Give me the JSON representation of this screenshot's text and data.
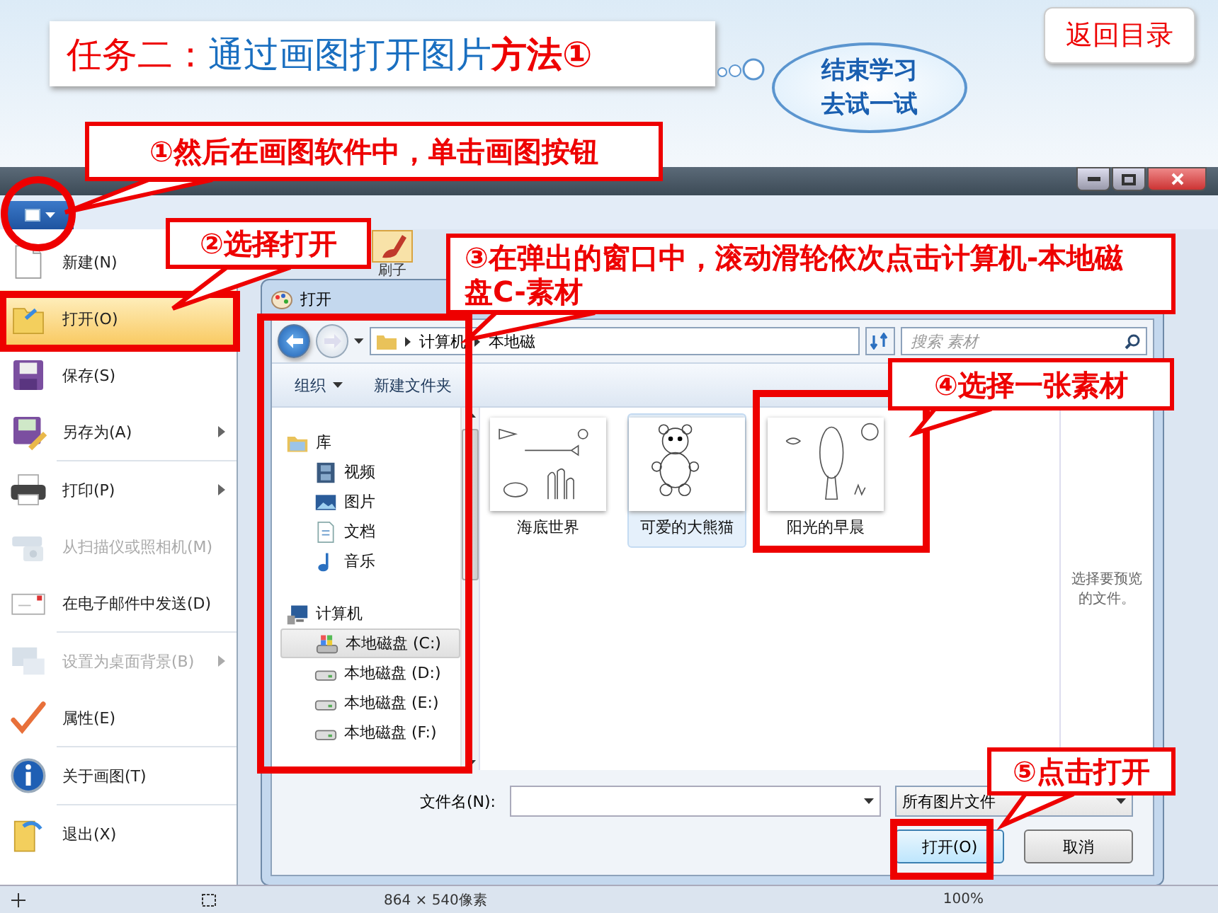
{
  "slide": {
    "title_label": "任务二：",
    "title_text": "通过画图打开图片",
    "title_emphasis": "方法①",
    "bubble_lines": [
      "结束学习",
      "去试一试"
    ],
    "back_button": "返回目录"
  },
  "callouts": [
    {
      "text": "①然后在画图软件中，单击画图按钮"
    },
    {
      "text": "②选择打开"
    },
    {
      "text": "③在弹出的窗口中，滚动滑轮依次点击计算机-本地磁盘C-素材"
    },
    {
      "text": "④选择一张素材"
    },
    {
      "text": "⑤点击打开"
    }
  ],
  "paint": {
    "ribbon_label": "刷子",
    "status_size": "864 × 540像素",
    "status_zoom": "100%"
  },
  "app_menu": {
    "items": [
      {
        "label": "新建(N)",
        "kind": "new",
        "selected": false,
        "disabled": false,
        "submenu": false,
        "separator_after": false
      },
      {
        "label": "打开(O)",
        "kind": "open",
        "selected": true,
        "disabled": false,
        "submenu": false,
        "separator_after": false
      },
      {
        "label": "保存(S)",
        "kind": "save",
        "selected": false,
        "disabled": false,
        "submenu": false,
        "separator_after": false
      },
      {
        "label": "另存为(A)",
        "kind": "saveas",
        "selected": false,
        "disabled": false,
        "submenu": true,
        "separator_after": true
      },
      {
        "label": "打印(P)",
        "kind": "print",
        "selected": false,
        "disabled": false,
        "submenu": true,
        "separator_after": false
      },
      {
        "label": "从扫描仪或照相机(M)",
        "kind": "scan",
        "selected": false,
        "disabled": true,
        "submenu": false,
        "separator_after": false
      },
      {
        "label": "在电子邮件中发送(D)",
        "kind": "email",
        "selected": false,
        "disabled": false,
        "submenu": false,
        "separator_after": true
      },
      {
        "label": "设置为桌面背景(B)",
        "kind": "desktop",
        "selected": false,
        "disabled": true,
        "submenu": true,
        "separator_after": false
      },
      {
        "label": "属性(E)",
        "kind": "properties",
        "selected": false,
        "disabled": false,
        "submenu": false,
        "separator_after": true
      },
      {
        "label": "关于画图(T)",
        "kind": "about",
        "selected": false,
        "disabled": false,
        "submenu": false,
        "separator_after": true
      },
      {
        "label": "退出(X)",
        "kind": "exit",
        "selected": false,
        "disabled": false,
        "submenu": false,
        "separator_after": false
      }
    ]
  },
  "dialog": {
    "title": "打开",
    "path": [
      "计算机",
      "本地磁"
    ],
    "search_placeholder": "搜索 素材",
    "toolbar": [
      {
        "label": "组织",
        "dropdown": true
      },
      {
        "label": "新建文件夹",
        "dropdown": false
      }
    ],
    "nav": [
      {
        "label": "库",
        "kind": "library",
        "selected": false,
        "children": [
          {
            "label": "视频",
            "kind": "video",
            "selected": false
          },
          {
            "label": "图片",
            "kind": "pictures",
            "selected": false
          },
          {
            "label": "文档",
            "kind": "documents",
            "selected": false
          },
          {
            "label": "音乐",
            "kind": "music",
            "selected": false
          }
        ]
      },
      {
        "label": "计算机",
        "kind": "computer",
        "selected": false,
        "children": [
          {
            "label": "本地磁盘 (C:)",
            "kind": "system_drive",
            "selected": true
          },
          {
            "label": "本地磁盘 (D:)",
            "kind": "drive",
            "selected": false
          },
          {
            "label": "本地磁盘 (E:)",
            "kind": "drive",
            "selected": false
          },
          {
            "label": "本地磁盘 (F:)",
            "kind": "drive",
            "selected": false
          }
        ]
      }
    ],
    "files": [
      {
        "name": "海底世界",
        "kind": "sea",
        "selected": false
      },
      {
        "name": "可爱的大熊猫",
        "kind": "panda",
        "selected": true
      },
      {
        "name": "阳光的早晨",
        "kind": "morning",
        "selected": false
      }
    ],
    "preview_hint": "选择要预览的文件。",
    "filename_label": "文件名(N):",
    "filetype": "所有图片文件",
    "open_button": "打开(O)",
    "cancel_button": "取消"
  }
}
